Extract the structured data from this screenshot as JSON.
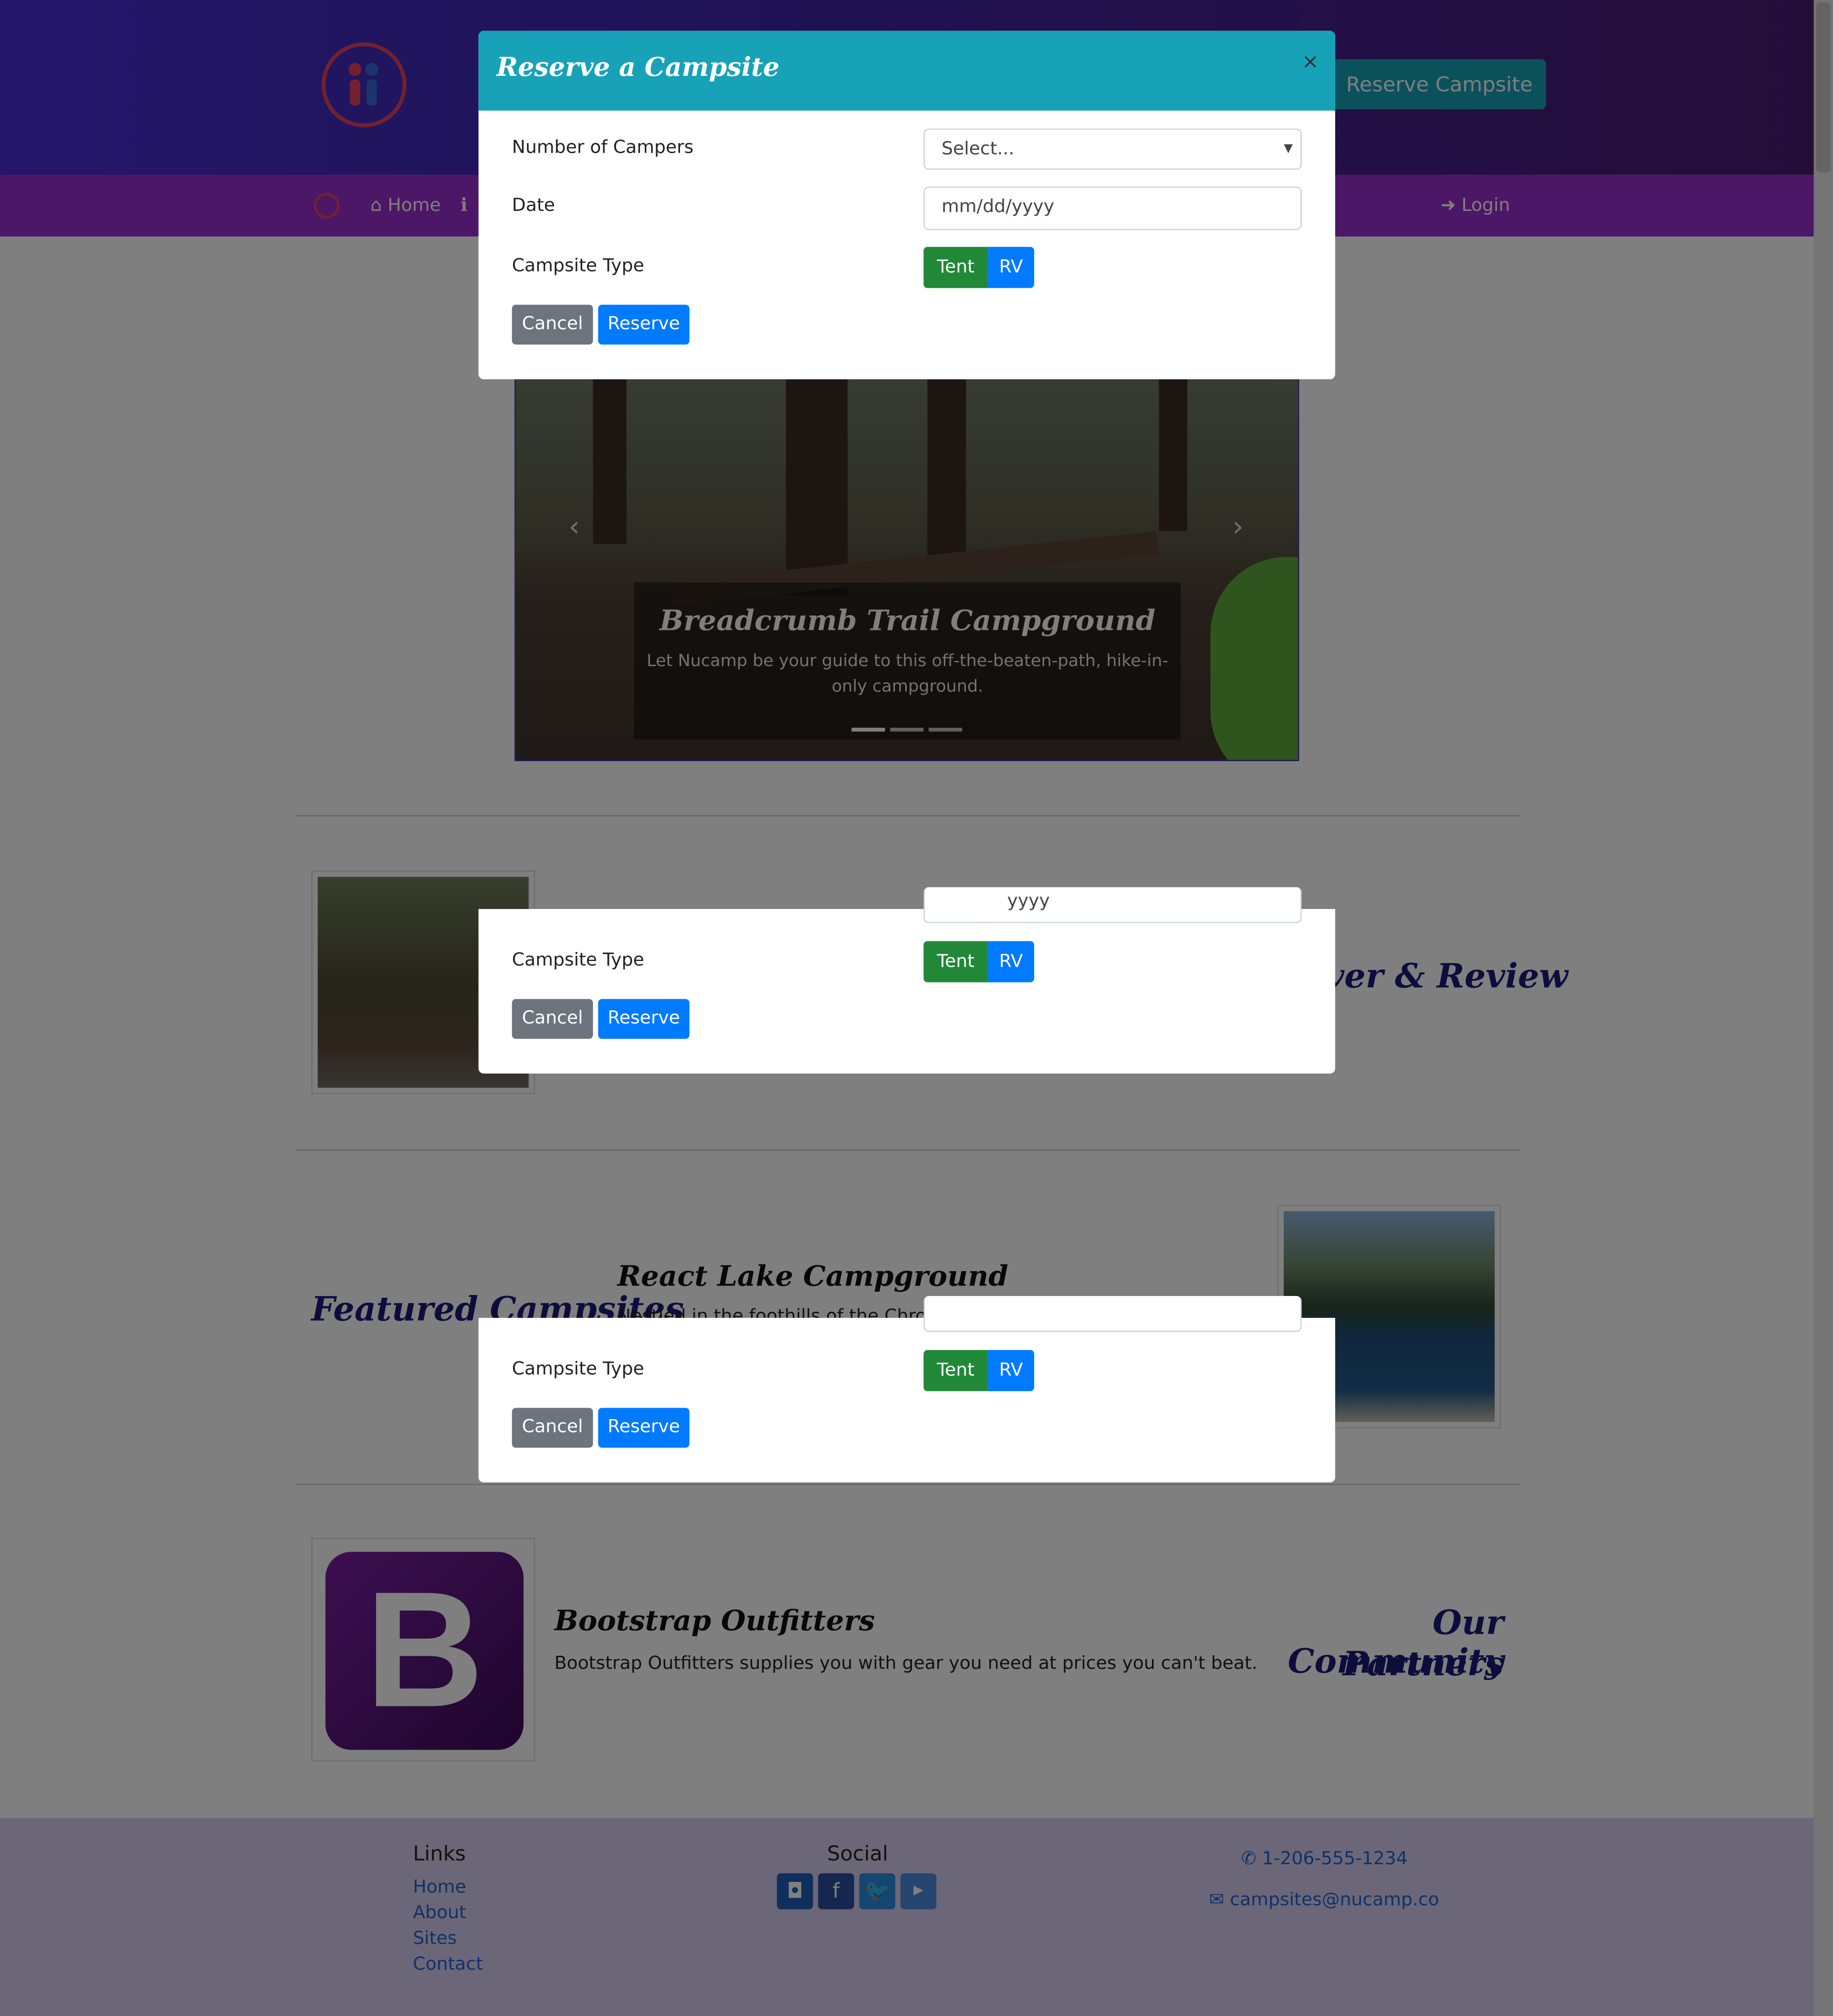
{
  "header": {
    "reserve_button": "Reserve Campsite"
  },
  "navbar": {
    "home": "Home",
    "login": "Login"
  },
  "carousel": {
    "title": "Breadcrumb Trail Campground",
    "text": "Let Nucamp be your guide to this off-the-beaten-path, hike-in-only campground."
  },
  "sections": {
    "review_title": "ver & Review",
    "featured_title": "Featured Campsites",
    "featured_item_title": "React Lake Campground",
    "featured_item_text": "Nestled in the foothills of the Chrome Mountains, this campground on the",
    "partners_title_line1": "Our Community",
    "partners_title_line2": "Partners",
    "partner_name": "Bootstrap Outfitters",
    "partner_text": "Bootstrap Outfitters supplies you with gear you need at prices you can't beat.",
    "partner_logo_letter": "B"
  },
  "footer": {
    "links_heading": "Links",
    "links": [
      "Home",
      "About",
      "Sites",
      "Contact"
    ],
    "social_heading": "Social",
    "social_icons": [
      "instagram-icon",
      "facebook-icon",
      "twitter-icon",
      "youtube-icon"
    ],
    "phone": "1-206-555-1234",
    "email": "campsites@nucamp.co"
  },
  "modal": {
    "title": "Reserve a Campsite",
    "close": "×",
    "campers_label": "Number of Campers",
    "campers_value": "Select...",
    "date_label": "Date",
    "date_placeholder": "mm/dd/yyyy",
    "date_partial": "yyyy",
    "type_label": "Campsite Type",
    "tent": "Tent",
    "rv": "RV",
    "cancel": "Cancel",
    "reserve": "Reserve"
  },
  "colors": {
    "header_gradient_start": "#4a2fd8",
    "navbar": "#9b2fd0",
    "modal_header": "#17a2b8",
    "tent_button": "#218838",
    "primary": "#007bff",
    "secondary": "#6c757d"
  }
}
